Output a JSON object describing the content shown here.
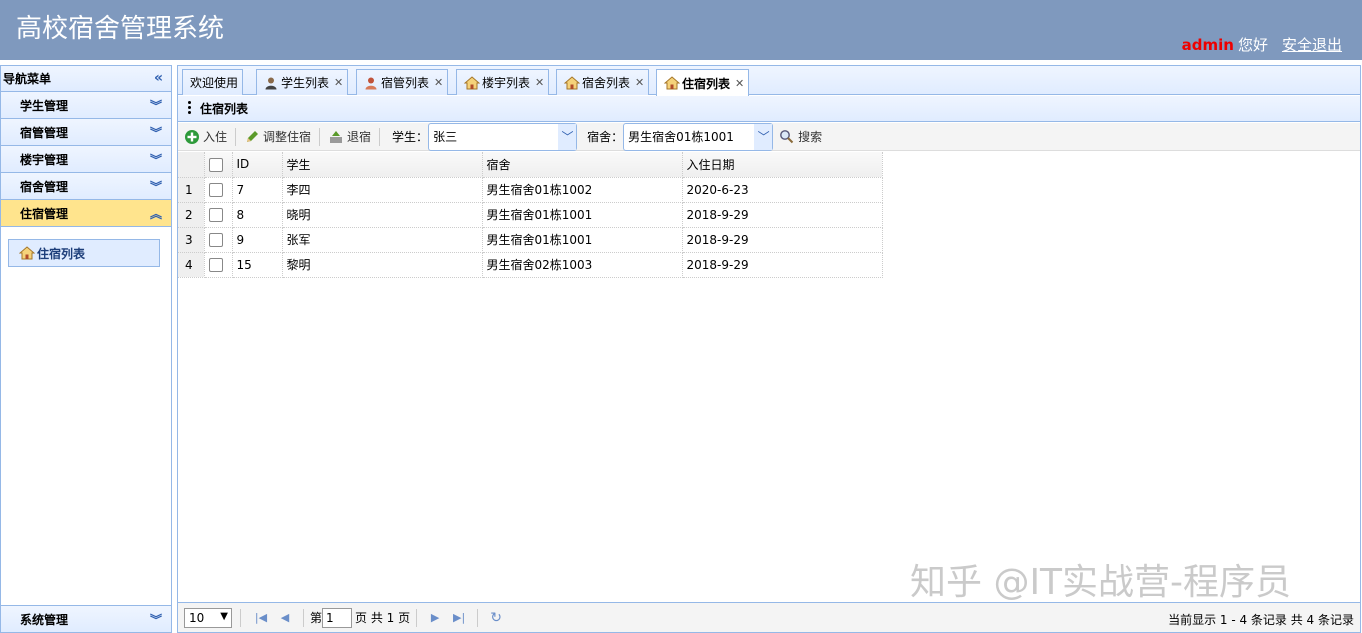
{
  "header": {
    "title": "高校宿舍管理系统",
    "user": "admin",
    "greeting": "您好",
    "logout": "安全退出"
  },
  "sidebar": {
    "title": "导航菜单",
    "items": [
      {
        "label": "学生管理"
      },
      {
        "label": "宿管管理"
      },
      {
        "label": "楼宇管理"
      },
      {
        "label": "宿舍管理"
      },
      {
        "label": "住宿管理"
      }
    ],
    "sub_items": [
      {
        "label": "住宿列表"
      }
    ],
    "bottom_item": {
      "label": "系统管理"
    }
  },
  "tabs": [
    {
      "label": "欢迎使用"
    },
    {
      "label": "学生列表"
    },
    {
      "label": "宿管列表"
    },
    {
      "label": "楼宇列表"
    },
    {
      "label": "宿舍列表"
    },
    {
      "label": "住宿列表"
    }
  ],
  "panel": {
    "title": "住宿列表"
  },
  "toolbar": {
    "checkin": "入住",
    "adjust": "调整住宿",
    "checkout": "退宿",
    "student_label": "学生：",
    "student_value": "张三",
    "dorm_label": "宿舍：",
    "dorm_value": "男生宿舍01栋1001",
    "search": "搜索"
  },
  "grid": {
    "columns": [
      "ID",
      "学生",
      "宿舍",
      "入住日期"
    ],
    "rows": [
      {
        "num": "1",
        "id": "7",
        "student": "李四",
        "dorm": "男生宿舍01栋1002",
        "date": "2020-6-23"
      },
      {
        "num": "2",
        "id": "8",
        "student": "晓明",
        "dorm": "男生宿舍01栋1001",
        "date": "2018-9-29"
      },
      {
        "num": "3",
        "id": "9",
        "student": "张军",
        "dorm": "男生宿舍01栋1001",
        "date": "2018-9-29"
      },
      {
        "num": "4",
        "id": "15",
        "student": "黎明",
        "dorm": "男生宿舍02栋1003",
        "date": "2018-9-29"
      }
    ]
  },
  "pager": {
    "page_size": "10",
    "page_prefix": "第",
    "page_value": "1",
    "page_suffix": "页 共 1 页",
    "info": "当前显示 1 - 4 条记录 共 4 条记录"
  },
  "watermark": "知乎 @IT实战营-程序员"
}
